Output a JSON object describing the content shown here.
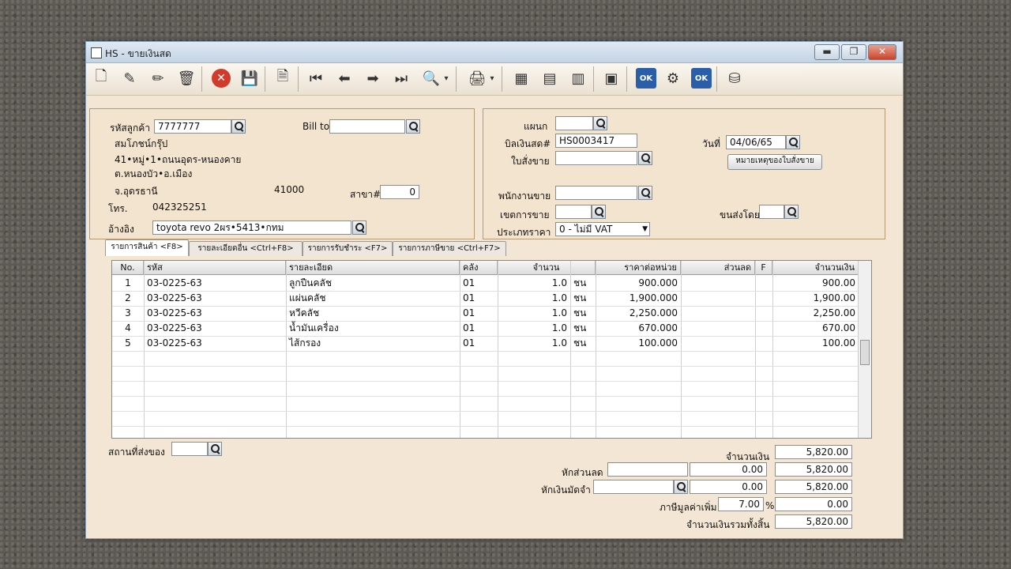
{
  "window": {
    "title": "HS - ขายเงินสด",
    "min": "▬",
    "max": "❐",
    "close": "✕"
  },
  "toolbar": {
    "new": "🗋",
    "edit": "✎",
    "pencil": "✏",
    "trash": "🗑",
    "cancel": "✕",
    "save": "💾",
    "print_preview": "🗎",
    "first": "⏮",
    "prev": "⬅",
    "next": "➡",
    "last": "⏭",
    "find": "🔍",
    "find_arrow": "▾",
    "print": "🖨",
    "print_arrow": "▾",
    "t1": "▦",
    "t2": "▤",
    "t3": "▥",
    "t4": "▣",
    "ok1": "OK",
    "tools": "⚙",
    "ok2": "OK",
    "db": "⛁"
  },
  "customer": {
    "code_label": "รหัสลูกค้า",
    "code_value": "7777777",
    "billto_label": "Bill to",
    "billto_value": "",
    "name": "สมโภชน์กรุ๊ป",
    "addr1": "41•หมู่•1•ถนนอุดร-หนองคาย",
    "addr2": "ต.หนองบัว•อ.เมือง",
    "addr3": "จ.อุดรธานี",
    "zip": "41000",
    "branch_label": "สาขา#",
    "branch_value": "0",
    "phone_label": "โทร.",
    "phone_value": "042325251",
    "ref_label": "อ้างอิง",
    "ref_value": "toyota revo 2ผร•5413•กทม"
  },
  "doc": {
    "dept_label": "แผนก",
    "dept_value": "",
    "bill_label": "บิลเงินสด#",
    "bill_value": "HS0003417",
    "order_label": "ใบสั่งขาย",
    "order_value": "",
    "date_label": "วันที่",
    "date_value": "04/06/65",
    "note_button": "หมายเหตุของใบสั่งขาย",
    "sales_label": "พนักงานขาย",
    "sales_value": "",
    "area_label": "เขตการขาย",
    "area_value": "",
    "ship_label": "ขนส่งโดย",
    "ship_value": "",
    "price_label": "ประเภทราคา",
    "price_value": "0 - ไม่มี VAT"
  },
  "tabs": [
    "รายการสินค้า <F8>",
    "รายละเอียดอื่น <Ctrl+F8>",
    "รายการรับชำระ <F7>",
    "รายการภาษีขาย <Ctrl+F7>"
  ],
  "grid": {
    "headers": [
      "No.",
      "รหัส",
      "รายละเอียด",
      "คลัง",
      "จำนวน",
      "ราคาต่อหน่วย",
      "ส่วนลด",
      "F",
      "จำนวนเงิน"
    ],
    "rows": [
      {
        "no": "1",
        "code": "03-0225-63",
        "desc": "ลูกปืนคลัช",
        "wh": "01",
        "qty": "1.0",
        "unit": "ชน",
        "price": "900.000",
        "disc": "",
        "f": "",
        "amount": "900.00"
      },
      {
        "no": "2",
        "code": "03-0225-63",
        "desc": "แผ่นคลัช",
        "wh": "01",
        "qty": "1.0",
        "unit": "ชน",
        "price": "1,900.000",
        "disc": "",
        "f": "",
        "amount": "1,900.00"
      },
      {
        "no": "3",
        "code": "03-0225-63",
        "desc": "หวีคลัช",
        "wh": "01",
        "qty": "1.0",
        "unit": "ชน",
        "price": "2,250.000",
        "disc": "",
        "f": "",
        "amount": "2,250.00"
      },
      {
        "no": "4",
        "code": "03-0225-63",
        "desc": "น้ำมันเครื่อง",
        "wh": "01",
        "qty": "1.0",
        "unit": "ชน",
        "price": "670.000",
        "disc": "",
        "f": "",
        "amount": "670.00"
      },
      {
        "no": "5",
        "code": "03-0225-63",
        "desc": "ไส้กรอง",
        "wh": "01",
        "qty": "1.0",
        "unit": "ชน",
        "price": "100.000",
        "disc": "",
        "f": "",
        "amount": "100.00"
      }
    ]
  },
  "footer": {
    "ship_place_label": "สถานที่ส่งของ",
    "ship_place_value": "",
    "amount_label": "จำนวนเงิน",
    "amount_value": "5,820.00",
    "discount_label": "หักส่วนลด",
    "discount_text": "",
    "discount_value": "0.00",
    "after_discount": "5,820.00",
    "deposit_label": "หักเงินมัดจำ",
    "deposit_text": "",
    "deposit_value": "0.00",
    "after_deposit": "5,820.00",
    "vat_label": "ภาษีมูลค่าเพิ่ม",
    "vat_rate": "7.00",
    "vat_percent": "%",
    "vat_value": "0.00",
    "total_label": "จำนวนเงินรวมทั้งสิ้น",
    "total_value": "5,820.00"
  }
}
